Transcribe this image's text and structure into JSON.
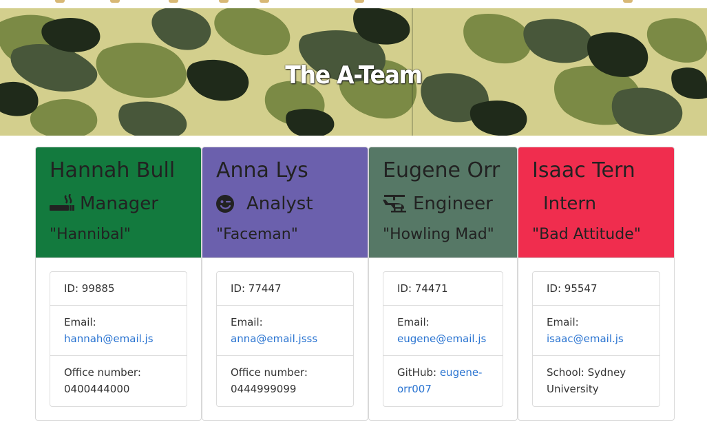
{
  "banner": {
    "title": "The A-Team"
  },
  "colors": {
    "manager": "#137a3e",
    "analyst": "#6b60ad",
    "engineer": "#567866",
    "intern": "#f02d4e",
    "link": "#2a74d1"
  },
  "cards": [
    {
      "name": "Hannah Bull",
      "role_icon": "cigarette-icon",
      "role": "Manager",
      "nickname": "\"Hannibal\"",
      "id_text": "ID: 99885",
      "email_label": "Email:",
      "email": "hannah@email.js",
      "extra_label": "Office number:",
      "extra_value": "0400444000"
    },
    {
      "name": "Anna Lys",
      "role_icon": "wink-face-icon",
      "role": "Analyst",
      "nickname": "\"Faceman\"",
      "id_text": "ID: 77447",
      "email_label": "Email:",
      "email": "anna@email.jsss",
      "extra_label": "Office number:",
      "extra_value": "0444999099"
    },
    {
      "name": "Eugene Orr",
      "role_icon": "helicopter-icon",
      "role": "Engineer",
      "nickname": "\"Howling Mad\"",
      "id_text": "ID: 74471",
      "email_label": "Email:",
      "email": "eugene@email.js",
      "extra_label": "GitHub:",
      "extra_value": "eugene-orr007"
    },
    {
      "name": "Isaac Tern",
      "role_icon": "",
      "role": "Intern",
      "nickname": "\"Bad Attitude\"",
      "id_text": "ID: 95547",
      "email_label": "Email:",
      "email": "isaac@email.js",
      "extra_label": "School:",
      "extra_value": "Sydney University"
    }
  ]
}
